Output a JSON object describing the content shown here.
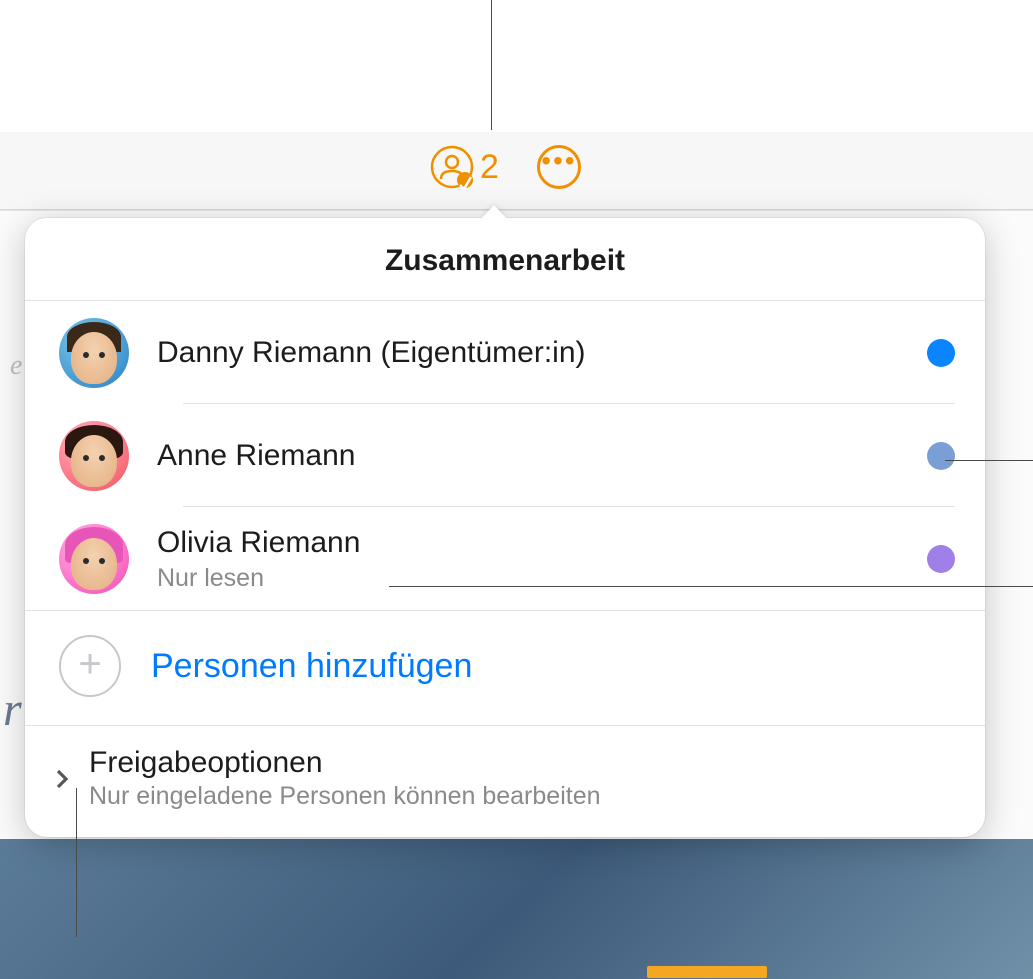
{
  "toolbar": {
    "collaboration_count": "2"
  },
  "popover": {
    "title": "Zusammenarbeit",
    "participants": [
      {
        "name": "Danny Riemann (Eigentümer:in)",
        "subtitle": "",
        "dot_color": "blue"
      },
      {
        "name": "Anne Riemann",
        "subtitle": "",
        "dot_color": "softblue"
      },
      {
        "name": "Olivia Riemann",
        "subtitle": "Nur lesen",
        "dot_color": "purple"
      }
    ],
    "add_people_label": "Personen hinzufügen",
    "share_options": {
      "title": "Freigabeoptionen",
      "subtitle": "Nur eingeladene Personen können bearbeiten"
    }
  }
}
